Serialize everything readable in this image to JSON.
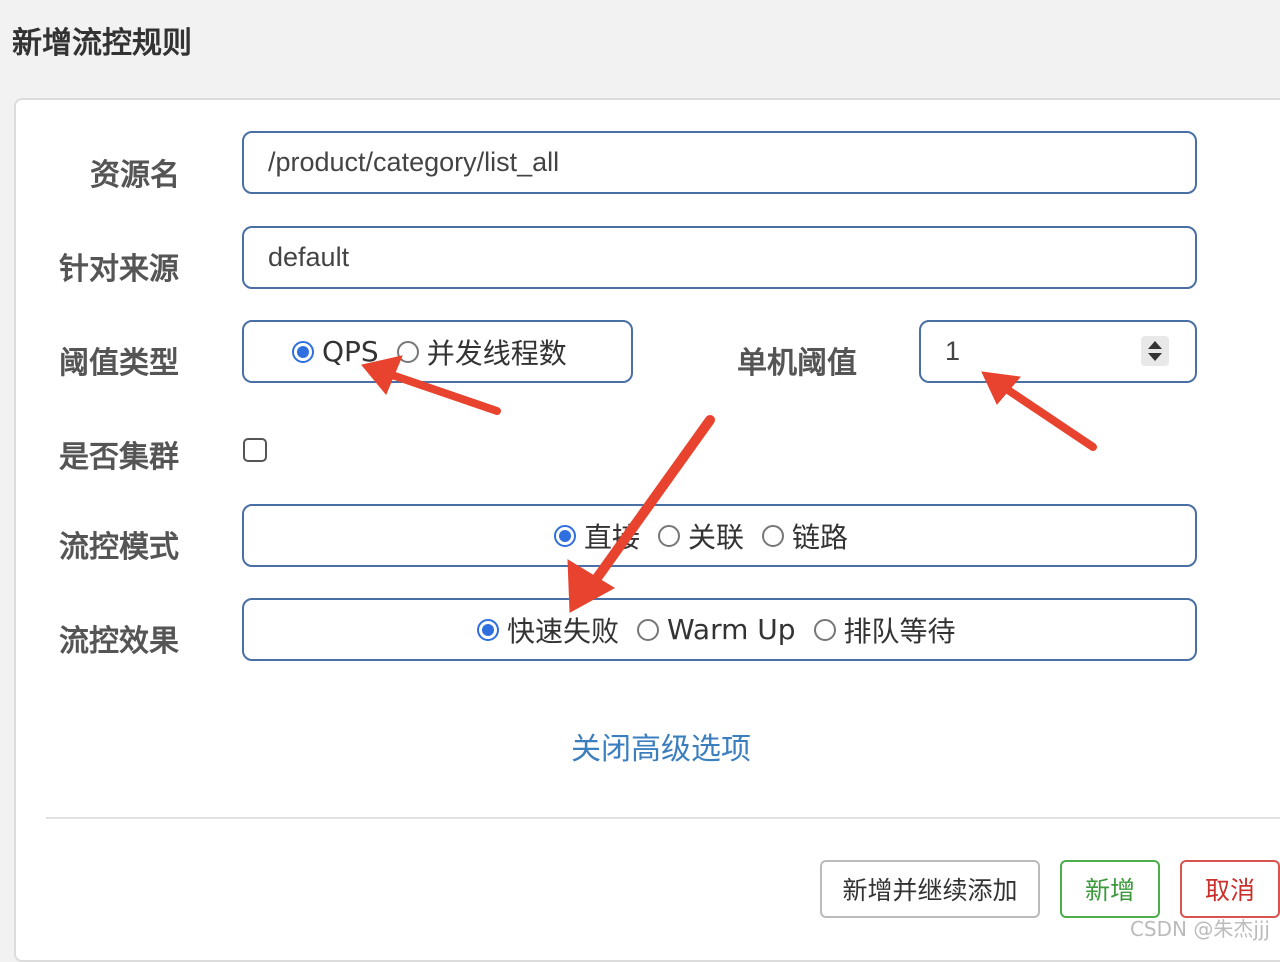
{
  "dialog": {
    "title": "新增流控规则"
  },
  "form": {
    "resource_label": "资源名",
    "resource_value": "/product/category/list_all",
    "source_label": "针对来源",
    "source_value": "default",
    "threshold_type_label": "阈值类型",
    "threshold_type_options": [
      "QPS",
      "并发线程数"
    ],
    "threshold_type_selected": "QPS",
    "single_threshold_label": "单机阈值",
    "single_threshold_value": "1",
    "cluster_label": "是否集群",
    "cluster_checked": false,
    "mode_label": "流控模式",
    "mode_options": [
      "直接",
      "关联",
      "链路"
    ],
    "mode_selected": "直接",
    "effect_label": "流控效果",
    "effect_options": [
      "快速失败",
      "Warm Up",
      "排队等待"
    ],
    "effect_selected": "快速失败"
  },
  "advanced_link": "关闭高级选项",
  "buttons": {
    "add_continue": "新增并继续添加",
    "add": "新增",
    "cancel": "取消"
  },
  "watermark": "CSDN @朱杰jjj",
  "colors": {
    "accent": "#2f6fe0",
    "link": "#3c7fbf",
    "success": "#4cae4c",
    "danger": "#d9534f",
    "annotation_arrow": "#e8432e"
  }
}
